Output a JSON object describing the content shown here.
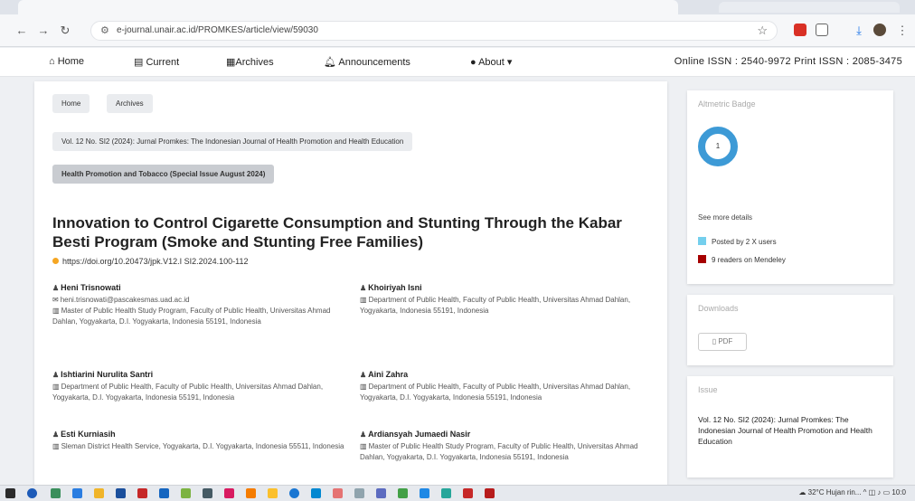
{
  "browser": {
    "url": "e-journal.unair.ac.id/PROMKES/article/view/59030",
    "colors": {
      "accent": "#1a73e8",
      "ext_red": "#d93025"
    }
  },
  "site_nav": {
    "home": "Home",
    "current": "Current",
    "archives": "Archives",
    "announcements": "Announcements",
    "about": "About ▾",
    "issn": "Online ISSN : 2540-9972   Print ISSN : 2085-3475"
  },
  "breadcrumb": {
    "home": "Home",
    "archives": "Archives",
    "issue": "Vol. 12 No. SI2 (2024): Jurnal Promkes: The Indonesian Journal of Health Promotion and Health Education",
    "section": "Health Promotion and Tobacco (Special Issue August 2024)"
  },
  "article": {
    "title": "Innovation to Control Cigarette Consumption and Stunting Through the Kabar Besti Program (Smoke and Stunting Free Families)",
    "doi": "https://doi.org/10.20473/jpk.V12.I SI2.2024.100-112"
  },
  "authors": [
    {
      "name": "Heni Trisnowati",
      "email": "heni.trisnowati@pascakesmas.uad.ac.id",
      "affiliation": "Master of Public Health Study Program, Faculty of Public Health, Universitas Ahmad Dahlan, Yogyakarta, D.I. Yogyakarta, Indonesia 55191, Indonesia"
    },
    {
      "name": "Khoiriyah Isni",
      "email": "",
      "affiliation": "Department of Public Health, Faculty of Public Health, Universitas Ahmad Dahlan, Yogyakarta, Indonesia 55191, Indonesia"
    },
    {
      "name": "Ishtiarini Nurulita Santri",
      "email": "",
      "affiliation": "Department of Public Health, Faculty of Public Health, Universitas Ahmad Dahlan, Yogyakarta, D.I. Yogyakarta, Indonesia 55191, Indonesia"
    },
    {
      "name": "Aini Zahra",
      "email": "",
      "affiliation": "Department of Public Health, Faculty of Public Health, Universitas Ahmad Dahlan, Yogyakarta, D.I. Yogyakarta, Indonesia 55191, Indonesia"
    },
    {
      "name": "Esti Kurniasih",
      "email": "",
      "affiliation": "Sleman District Health Service, Yogyakarta, D.I. Yogyakarta, Indonesia 55511, Indonesia"
    },
    {
      "name": "Ardiansyah Jumaedi Nasir",
      "email": "",
      "affiliation": "Master of Public Health Study Program, Faculty of Public Health, Universitas Ahmad Dahlan, Yogyakarta, D.I. Yogyakarta, Indonesia 55191, Indonesia"
    }
  ],
  "altmetric": {
    "header": "Altmetric Badge",
    "score": "1",
    "see_more": "See more details",
    "posted": "Posted by 2 X users",
    "readers": "9 readers on Mendeley",
    "colors": {
      "x": "#74cfed",
      "mendeley": "#a60000",
      "donut": "#3d9ad6"
    }
  },
  "downloads": {
    "header": "Downloads",
    "pdf": "PDF"
  },
  "issue": {
    "header": "Issue",
    "text": "Vol. 12 No. SI2 (2024): Jurnal Promkes: The Indonesian Journal of Health Promotion and Health Education"
  },
  "taskbar": {
    "weather": "32°C Hujan rin...",
    "time": "10:0"
  }
}
